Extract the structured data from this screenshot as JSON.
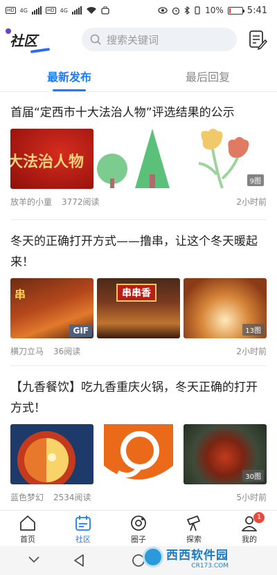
{
  "status_bar": {
    "battery": "10%",
    "time": "5:41",
    "battery_level": 0.1,
    "signal_label_1": "4G",
    "signal_label_2": "4G"
  },
  "header": {
    "logo_text": "社区",
    "search_placeholder": "搜索关键词"
  },
  "tabs": [
    {
      "label": "最新发布",
      "active": true
    },
    {
      "label": "最后回复",
      "active": false
    }
  ],
  "posts": [
    {
      "title": "首届“定西市十大法治人物”评选结果的公示",
      "image_caption": "大法治人物",
      "image_count": "9图",
      "author": "放羊的小童",
      "reads": "3772阅读",
      "time": "2小时前"
    },
    {
      "title": "冬天的正确打开方式——撸串，让这个冬天暖起来！",
      "image_caption_1": "串",
      "image_caption_2": "串串香",
      "gif_label": "GIF",
      "image_count": "13图",
      "author": "横刀立马",
      "reads": "36阅读",
      "time": "2小时前"
    },
    {
      "title": "【九香餐饮】吃九香重庆火锅，冬天正确的打开方式！",
      "image_count": "30图",
      "author": "蓝色梦幻",
      "reads": "2534阅读",
      "time": "5小时前"
    }
  ],
  "bottom_nav": [
    {
      "label": "首页",
      "active": false
    },
    {
      "label": "社区",
      "active": true
    },
    {
      "label": "圈子",
      "active": false
    },
    {
      "label": "探索",
      "active": false
    },
    {
      "label": "我的",
      "active": false,
      "badge": "1"
    }
  ],
  "watermark": {
    "main": "西西软件园",
    "sub": "CR173.COM"
  },
  "colors": {
    "accent": "#1e7bf0",
    "badge_red": "#e84a3c"
  }
}
